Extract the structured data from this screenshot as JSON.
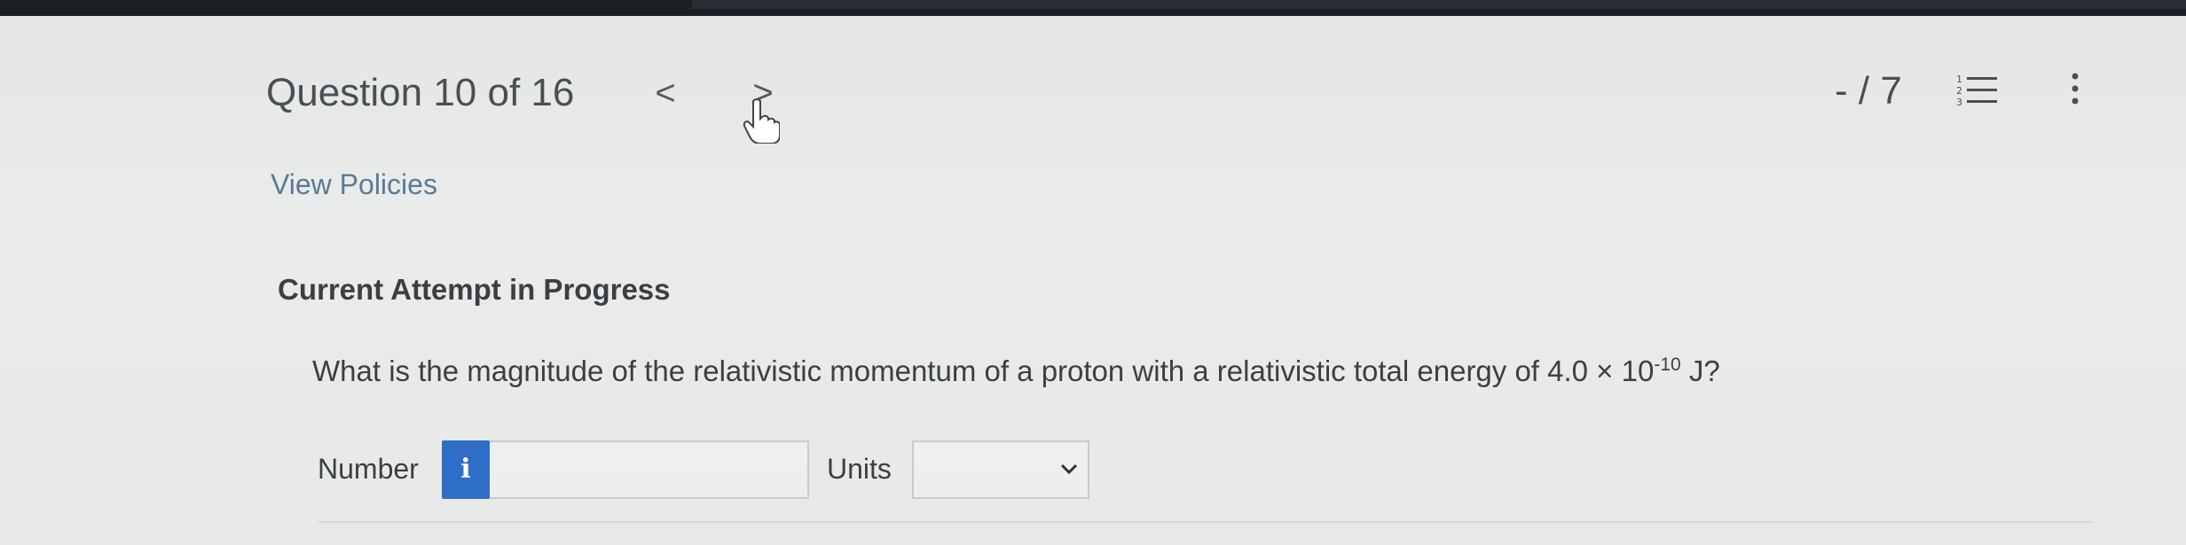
{
  "header": {
    "question_counter": "Question 10 of 16",
    "prev_label": "<",
    "next_label": ">",
    "score": "- / 7"
  },
  "links": {
    "view_policies": "View Policies"
  },
  "attempt": {
    "status": "Current Attempt in Progress"
  },
  "question": {
    "text_before": "What is the magnitude of the relativistic momentum of a proton with a relativistic total energy of 4.0 × 10",
    "exponent": "-10",
    "text_after": " J?"
  },
  "answer": {
    "number_label": "Number",
    "info_label": "i",
    "number_value": "",
    "units_label": "Units",
    "units_selected": ""
  },
  "colors": {
    "info_button": "#2f6ec7",
    "link": "#5a7a95",
    "text": "#3b3f44"
  },
  "icons": [
    "chevron-left-icon",
    "chevron-right-icon",
    "hand-cursor-icon",
    "numbered-list-icon",
    "more-vertical-icon",
    "chevron-down-icon"
  ]
}
